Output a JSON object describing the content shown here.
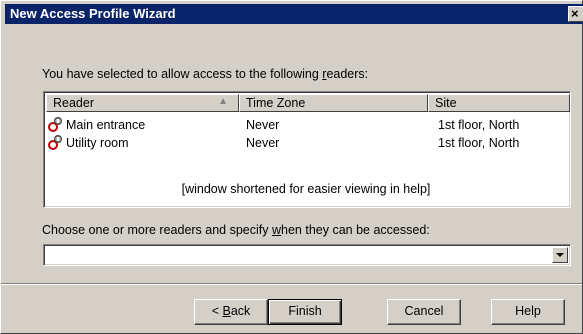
{
  "window": {
    "title": "New Access Profile Wizard",
    "close_glyph": "×"
  },
  "intro_text": {
    "before": "You have selected to allow access to the following ",
    "accel": "r",
    "after": "eaders:"
  },
  "list": {
    "columns": [
      {
        "label": "Reader",
        "sort_icon": "▲"
      },
      {
        "label": "Time Zone"
      },
      {
        "label": "Site"
      }
    ],
    "rows": [
      {
        "reader": "Main entrance",
        "time_zone": "Never",
        "site": "1st floor, North",
        "icon": "reader-icon"
      },
      {
        "reader": "Utility room",
        "time_zone": "Never",
        "site": "1st floor, North",
        "icon": "reader-icon"
      }
    ],
    "note": "[window shortened for easier viewing in  help]"
  },
  "choose_text": {
    "before": "Choose one or more readers and specify ",
    "accel": "w",
    "after": "hen they can be accessed:"
  },
  "combo": {
    "value": ""
  },
  "buttons": {
    "back": {
      "prefix": "< ",
      "accel": "B",
      "rest": "ack"
    },
    "finish": "Finish",
    "cancel": "Cancel",
    "help": "Help"
  }
}
